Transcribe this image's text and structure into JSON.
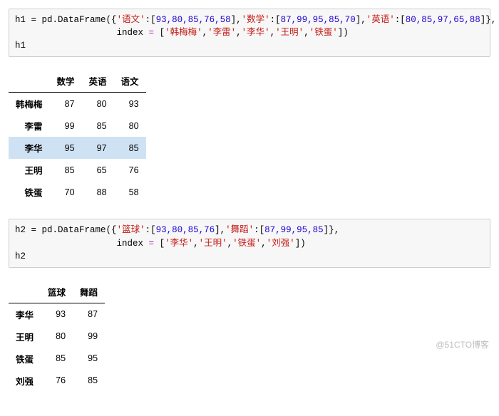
{
  "code1": {
    "v": "h1",
    "eq": " = ",
    "fn": "pd.DataFrame",
    "op1": "({",
    "k1": "'语文'",
    "c": ":[",
    "a1": "93,80,85,76,58",
    "cl": "],",
    "k2": "'数学'",
    "a2": "87,99,95,85,70",
    "k3": "'英语'",
    "a3": "80,85,97,65,88",
    "end1": "]}",
    "comma": ",",
    "line2_indent": "                   ",
    "idx_kw": "index ",
    "eq2": "= ",
    "idx_open": "[",
    "i1": "'韩梅梅'",
    "i2": "'李雷'",
    "i3": "'李华'",
    "i4": "'王明'",
    "i5": "'铁蛋'",
    "idx_close": "])",
    "line3": "h1"
  },
  "table1": {
    "col1": "数学",
    "col2": "英语",
    "col3": "语文",
    "rows": [
      {
        "idx": "韩梅梅",
        "c1": "87",
        "c2": "80",
        "c3": "93"
      },
      {
        "idx": "李雷",
        "c1": "99",
        "c2": "85",
        "c3": "80"
      },
      {
        "idx": "李华",
        "c1": "95",
        "c2": "97",
        "c3": "85"
      },
      {
        "idx": "王明",
        "c1": "85",
        "c2": "65",
        "c3": "76"
      },
      {
        "idx": "铁蛋",
        "c1": "70",
        "c2": "88",
        "c3": "58"
      }
    ]
  },
  "code2": {
    "v": "h2",
    "eq": " = ",
    "fn": "pd.DataFrame",
    "op1": "({",
    "k1": "'篮球'",
    "c": ":[",
    "a1": "93,80,85,76",
    "cl": "],",
    "k2": "'舞蹈'",
    "a2": "87,99,95,85",
    "end1": "]}",
    "comma": ",",
    "line2_indent": "                   ",
    "idx_kw": "index ",
    "eq2": "= ",
    "idx_open": "[",
    "i1": "'李华'",
    "i2": "'王明'",
    "i3": "'铁蛋'",
    "i4": "'刘强'",
    "idx_close": "])",
    "line3": "h2"
  },
  "table2": {
    "col1": "篮球",
    "col2": "舞蹈",
    "rows": [
      {
        "idx": "李华",
        "c1": "93",
        "c2": "87"
      },
      {
        "idx": "王明",
        "c1": "80",
        "c2": "99"
      },
      {
        "idx": "铁蛋",
        "c1": "85",
        "c2": "95"
      },
      {
        "idx": "刘强",
        "c1": "76",
        "c2": "85"
      }
    ]
  },
  "watermark": "@51CTO博客",
  "chart_data": [
    {
      "type": "table",
      "title": "h1",
      "index": [
        "韩梅梅",
        "李雷",
        "李华",
        "王明",
        "铁蛋"
      ],
      "columns": [
        "数学",
        "英语",
        "语文"
      ],
      "data": [
        [
          87,
          80,
          93
        ],
        [
          99,
          85,
          80
        ],
        [
          95,
          97,
          85
        ],
        [
          85,
          65,
          76
        ],
        [
          70,
          88,
          58
        ]
      ]
    },
    {
      "type": "table",
      "title": "h2",
      "index": [
        "李华",
        "王明",
        "铁蛋",
        "刘强"
      ],
      "columns": [
        "篮球",
        "舞蹈"
      ],
      "data": [
        [
          93,
          87
        ],
        [
          80,
          99
        ],
        [
          85,
          95
        ],
        [
          76,
          85
        ]
      ]
    }
  ]
}
